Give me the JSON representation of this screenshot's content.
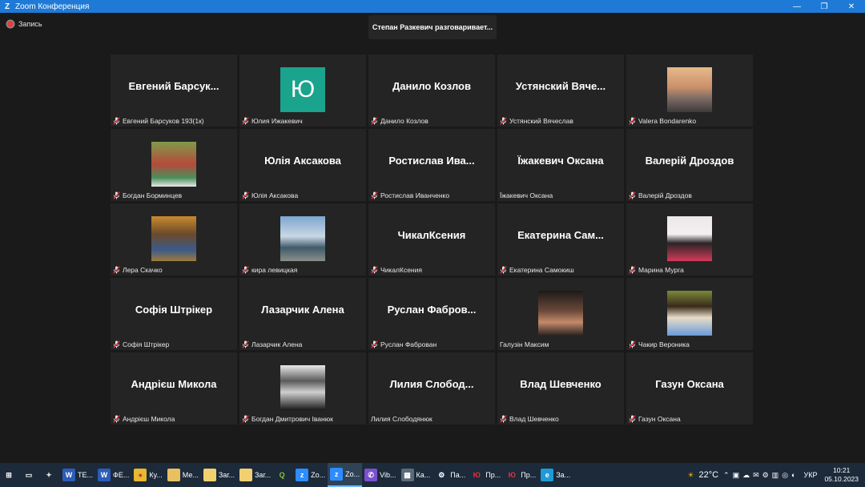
{
  "window": {
    "title": "Zoom Конференция",
    "controls": {
      "minimize": "—",
      "maximize": "❐",
      "close": "✕"
    }
  },
  "recording": {
    "label": "Запись"
  },
  "speaker_banner": "Степан Разкевич разговаривает...",
  "participants": [
    {
      "big_name": "Евгений  Барсук...",
      "label": "Евгений Барсуков 193(1к)",
      "muted": true
    },
    {
      "avatar": "Ю",
      "avatar_color": "#1aa38d",
      "label": "Юлия Ижакевич",
      "muted": true
    },
    {
      "big_name": "Данило Козлов",
      "label": "Данило Козлов",
      "muted": true
    },
    {
      "big_name": "Устянский  Вяче...",
      "label": "Устянский Вячеслав",
      "muted": true
    },
    {
      "photo": "city-photo",
      "label": "Valera Bondarenko",
      "muted": true
    },
    {
      "photo": "boy-photo",
      "label": "Богдан Борминцев",
      "muted": true
    },
    {
      "big_name": "Юлія Аксакова",
      "label": "Юлія Аксакова",
      "muted": true
    },
    {
      "big_name": "Ростислав  Ива...",
      "label": "Ростислав Иванченко",
      "muted": true
    },
    {
      "big_name": "Їжакевич Оксана",
      "label": "Їжакевич Оксана",
      "muted": false
    },
    {
      "big_name": "Валерій Дроздов",
      "label": "Валерій Дроздов",
      "muted": true
    },
    {
      "photo": "girl-autumn-photo",
      "label": "Лера Скачко",
      "muted": true
    },
    {
      "photo": "seaside-photo",
      "label": "кира левицкая",
      "muted": true
    },
    {
      "big_name": "ЧикалКсения",
      "label": "ЧикалКсения",
      "muted": true
    },
    {
      "big_name": "Екатерина  Сам...",
      "label": "Екатерина Самокиш",
      "muted": true
    },
    {
      "photo": "girl-flowers-photo",
      "label": "Марина Мурга",
      "muted": true
    },
    {
      "big_name": "Софія Штрікер",
      "label": "Софія Штрікер",
      "muted": true
    },
    {
      "big_name": "Лазарчик Алена",
      "label": "Лазарчик Алена",
      "muted": true
    },
    {
      "big_name": "Руслан  Фабров...",
      "label": "Руслан Фаброван",
      "muted": true
    },
    {
      "photo": "boy-selfie-photo",
      "label": "Галузін Максим",
      "muted": false
    },
    {
      "photo": "girl-park-photo",
      "label": "Чакир Вероника",
      "muted": true
    },
    {
      "big_name": "Андрієш Микола",
      "label": "Андрієш Микола",
      "muted": true
    },
    {
      "photo": "man-bw-photo",
      "label": "Богдан Дмитрович Іванюк",
      "muted": true
    },
    {
      "big_name": "Лилия  Слобод...",
      "label": "Лилия Слободянюк",
      "muted": false
    },
    {
      "big_name": "Влад Шевченко",
      "label": "Влад Шевченко",
      "muted": true
    },
    {
      "big_name": "Газун Оксана",
      "label": "Газун Оксана",
      "muted": true
    }
  ],
  "taskbar": {
    "items": [
      {
        "icon": "windows-start-icon",
        "label": ""
      },
      {
        "icon": "task-view-icon",
        "label": ""
      },
      {
        "icon": "app-icon",
        "label": ""
      },
      {
        "icon": "word-icon",
        "label": "TE..."
      },
      {
        "icon": "word-icon",
        "label": "ФЕ..."
      },
      {
        "icon": "chrome-icon",
        "label": "Ку..."
      },
      {
        "icon": "folder-icon",
        "label": "Ме..."
      },
      {
        "icon": "document-icon",
        "label": "Заг..."
      },
      {
        "icon": "document-icon",
        "label": "Заг..."
      },
      {
        "icon": "qgis-icon",
        "label": ""
      },
      {
        "icon": "zoom-icon",
        "label": "Zo..."
      },
      {
        "icon": "zoom-icon",
        "label": "Zo...",
        "active": true
      },
      {
        "icon": "viber-icon",
        "label": "Vib..."
      },
      {
        "icon": "calculator-icon",
        "label": "Ка..."
      },
      {
        "icon": "settings-icon",
        "label": "Па..."
      },
      {
        "icon": "pr-icon",
        "label": "Пр..."
      },
      {
        "icon": "pr-icon",
        "label": "Пр..."
      },
      {
        "icon": "edge-icon",
        "label": "За..."
      }
    ],
    "weather": "22°C",
    "lang": "УКР",
    "time": "10:21",
    "date": "05.10.2023"
  }
}
